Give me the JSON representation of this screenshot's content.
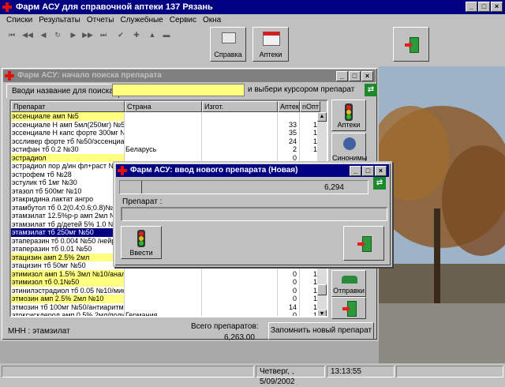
{
  "app": {
    "title": "Фарм АСУ для справочной аптеки 137 Рязань",
    "window_buttons": [
      "_",
      "□",
      "×"
    ]
  },
  "menu": [
    "Списки",
    "Результаты",
    "Отчеты",
    "Служебные",
    "Сервис",
    "Окна"
  ],
  "toolbar": {
    "nav_icons": [
      "first-icon",
      "prev-page-icon",
      "prev-icon",
      "refresh-icon",
      "next-icon",
      "next-page-icon",
      "last-icon",
      "check-icon",
      "plus-icon",
      "minus-icon",
      "dash-icon"
    ],
    "nav_glyphs": [
      "⏮",
      "◀◀",
      "◀",
      "↻",
      "▶",
      "▶▶",
      "⏭",
      "✔",
      "✚",
      "▲",
      "▬"
    ],
    "help_label": "Справка",
    "pharmacy_label": "Аптеки"
  },
  "search_window": {
    "title": "Фарм АСУ: начало поиска препарата",
    "tab_label": "Вводи название для поиска",
    "search_value": "",
    "hint": "и выбери курсором препарат",
    "columns": [
      "Препарат",
      "Страна",
      "Изгот.",
      "Аптек",
      "nОпт"
    ],
    "rows": [
      {
        "name": "эссенциале амп №5",
        "country": "",
        "maker": "",
        "apteki": "",
        "nopt": "",
        "style": "yellow"
      },
      {
        "name": "эссенциале Н амп 5мл(250мг) №5",
        "country": "",
        "maker": "",
        "apteki": "33",
        "nopt": "1",
        "style": ""
      },
      {
        "name": "эссенциале Н капс форте 300мг №",
        "country": "",
        "maker": "",
        "apteki": "35",
        "nopt": "1",
        "style": ""
      },
      {
        "name": "эссливер форте тб №50/эссенциал",
        "country": "",
        "maker": "",
        "apteki": "24",
        "nopt": "1",
        "style": ""
      },
      {
        "name": "эстифан тб 0.2 №30",
        "country": "Беларусь",
        "maker": "",
        "apteki": "2",
        "nopt": "1",
        "style": ""
      },
      {
        "name": "эстрадиол",
        "country": "",
        "maker": "",
        "apteki": "0",
        "nopt": "",
        "style": "yellow"
      },
      {
        "name": "эстрадиол пор д/ин фл+раст №",
        "country": "",
        "maker": "",
        "apteki": "",
        "nopt": "",
        "style": ""
      },
      {
        "name": "эстрофем тб №28",
        "country": "",
        "maker": "",
        "apteki": "",
        "nopt": "",
        "style": ""
      },
      {
        "name": "эстулик тб 1мг №30",
        "country": "",
        "maker": "",
        "apteki": "",
        "nopt": "",
        "style": ""
      },
      {
        "name": "этазол тб 500мг №10",
        "country": "",
        "maker": "",
        "apteki": "",
        "nopt": "",
        "style": ""
      },
      {
        "name": "этакридина лактат ангро",
        "country": "",
        "maker": "",
        "apteki": "",
        "nopt": "",
        "style": ""
      },
      {
        "name": "этамбутол тб 0.2(0.4;0.6;0.8)№",
        "country": "",
        "maker": "",
        "apteki": "",
        "nopt": "",
        "style": ""
      },
      {
        "name": "этамзилат 12.5%р-р амп 2мл №",
        "country": "",
        "maker": "",
        "apteki": "",
        "nopt": "",
        "style": ""
      },
      {
        "name": "этамзилат тб д/детей 5% 1.0 №",
        "country": "",
        "maker": "",
        "apteki": "",
        "nopt": "",
        "style": ""
      },
      {
        "name": "этамзилат тб 250мг №50",
        "country": "",
        "maker": "",
        "apteki": "",
        "nopt": "",
        "style": "sel"
      },
      {
        "name": "этаперазин тб 0.004 №50 /нейр",
        "country": "",
        "maker": "",
        "apteki": "",
        "nopt": "",
        "style": ""
      },
      {
        "name": "этаперазин тб 0.01 №50",
        "country": "",
        "maker": "",
        "apteki": "",
        "nopt": "",
        "style": ""
      },
      {
        "name": "этацизин амп 2.5% 2мл",
        "country": "",
        "maker": "",
        "apteki": "",
        "nopt": "",
        "style": "yellow"
      },
      {
        "name": "этацизин тб 50мг №50",
        "country": "",
        "maker": "",
        "apteki": "",
        "nopt": "",
        "style": ""
      },
      {
        "name": "этимизол амп 1.5% 3мл №10/анале",
        "country": "",
        "maker": "",
        "apteki": "0",
        "nopt": "1",
        "style": "yellow"
      },
      {
        "name": "этимизол тб 0.1№50",
        "country": "",
        "maker": "",
        "apteki": "0",
        "nopt": "1",
        "style": "yellow"
      },
      {
        "name": "этинилэстрадиол тб 0.05 №10/мик",
        "country": "",
        "maker": "",
        "apteki": "0",
        "nopt": "1",
        "style": ""
      },
      {
        "name": "этмозин амп 2.5% 2мл №10",
        "country": "",
        "maker": "",
        "apteki": "0",
        "nopt": "1",
        "style": "yellow"
      },
      {
        "name": "этмозин тб 100мг №50/антиаритми",
        "country": "",
        "maker": "",
        "apteki": "14",
        "nopt": "1",
        "style": ""
      },
      {
        "name": "этоксисклерол амп 0.5% 2мл/полид",
        "country": "Германия",
        "maker": "",
        "apteki": "0",
        "nopt": "1",
        "style": ""
      }
    ],
    "side_buttons": {
      "pharmacies": "Аптеки",
      "synonyms": "Синонимы",
      "send": "Отправки"
    },
    "mnn_label": "МНН : этамзилат",
    "total_label": "Всего препаратов:",
    "total_value": "6,263.00",
    "remember_button": "Запомнить новый препарат"
  },
  "new_drug_window": {
    "title": "Фарм АСУ: ввод нового препарата  (Новая)",
    "progress_value": "6,294",
    "drug_label": "Препарат :",
    "drug_value": "",
    "enter_button": "Ввести"
  },
  "status": {
    "date": "Четверг, , 5/09/2002",
    "time": "13:13:55"
  },
  "colors": {
    "title_active": "#000080",
    "highlight": "#ffff80",
    "exit_green": "#2a9a3a"
  }
}
